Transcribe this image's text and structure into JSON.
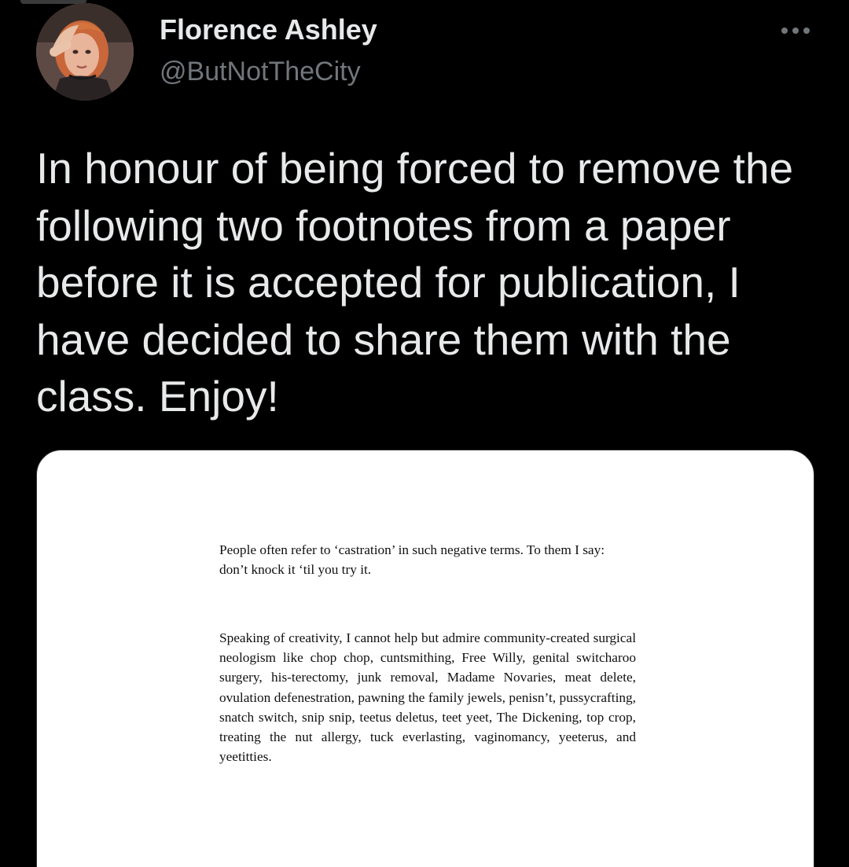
{
  "tweet": {
    "author": {
      "display_name": "Florence Ashley",
      "handle": "@ButNotTheCity",
      "avatar_icon": "profile-photo"
    },
    "more_icon": "more-horizontal-icon",
    "text": "In honour of being forced to remove the following two footnotes from a paper before it is accepted for publication, I have decided to share them with the class. Enjoy!",
    "media": {
      "footnotes": [
        "People often refer to ‘castration’ in such negative terms. To them I say: don’t knock it ‘til you try it.",
        "Speaking of creativity, I cannot help but admire community-created surgical neologism like chop chop, cuntsmithing, Free Willy, genital switcharoo surgery, his-terectomy, junk removal, Madame Novaries, meat delete, ovulation defenestration, pawning the family jewels, penisn’t, pussycrafting, snatch switch, snip snip, teetus deletus, teet yeet, The Dickening, top crop, treating the nut allergy, tuck everlasting, vaginomancy, yeeterus, and yeetitties."
      ]
    }
  },
  "colors": {
    "background": "#000000",
    "primary_text": "#e7e9ea",
    "secondary_text": "#71767b",
    "card_background": "#ffffff",
    "card_text": "#111111"
  }
}
